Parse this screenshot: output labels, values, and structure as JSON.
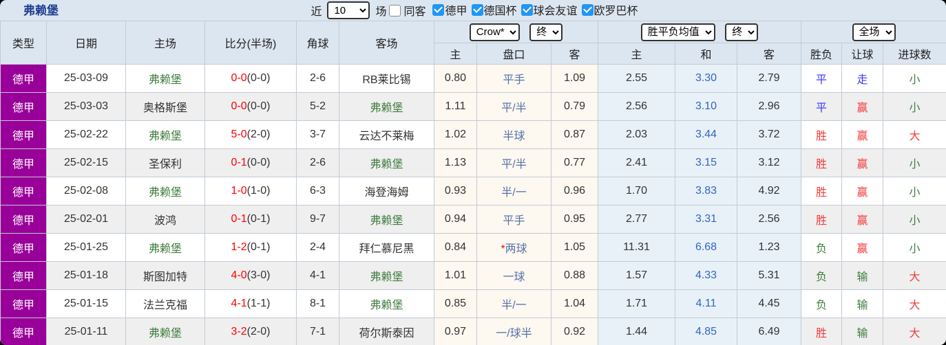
{
  "topbar": {
    "title": "弗赖堡",
    "near_label": "近",
    "games_select": "10",
    "games_label": "场",
    "same_away_label": "同客",
    "leagues": [
      {
        "label": "德甲",
        "checked": true
      },
      {
        "label": "德国杯",
        "checked": true
      },
      {
        "label": "球会友谊",
        "checked": true
      },
      {
        "label": "欧罗巴杯",
        "checked": true
      }
    ]
  },
  "header": {
    "static_cols": [
      "类型",
      "日期",
      "主场",
      "比分(半场)",
      "角球",
      "客场"
    ],
    "odds_group": {
      "bookmaker_select": "Crow*",
      "time_select": "终",
      "sub": [
        "主",
        "盘口",
        "客"
      ]
    },
    "avg_group": {
      "type_select": "胜平负均值",
      "time_select": "终",
      "sub": [
        "主",
        "和",
        "客"
      ]
    },
    "scope_group": {
      "scope_select": "全场",
      "sub": [
        "胜负",
        "让球",
        "进球数"
      ]
    }
  },
  "colors": {
    "league_badge": "#990099",
    "checkbox_accent": "#2196f3",
    "score_red": "#ff0000",
    "result_red": "#f43b3b",
    "result_blue": "#3b3bff",
    "result_green": "#3f7d3f",
    "draw_odds_blue": "#3465c0",
    "panel_bg": "#dce6f1"
  },
  "rows": [
    {
      "type": "德甲",
      "date": "25-03-09",
      "home": "弗赖堡",
      "home_color": "green",
      "score_ft": "0-0",
      "score_ht": "(0-0)",
      "corner": "2-6",
      "away": "RB莱比锡",
      "away_color": "dark",
      "odds_home": "0.80",
      "handicap": "平手",
      "handicap_star": false,
      "odds_away": "1.09",
      "avg_home": "2.55",
      "avg_draw": "3.30",
      "avg_away": "2.79",
      "result": "平",
      "result_color": "blue",
      "let_result": "走",
      "let_result_color": "blue",
      "goals": "小",
      "goals_color": "green"
    },
    {
      "type": "德甲",
      "date": "25-03-03",
      "home": "奥格斯堡",
      "home_color": "dark",
      "score_ft": "0-0",
      "score_ht": "(0-0)",
      "corner": "5-2",
      "away": "弗赖堡",
      "away_color": "green",
      "odds_home": "1.11",
      "handicap": "平/半",
      "handicap_star": false,
      "odds_away": "0.79",
      "avg_home": "2.56",
      "avg_draw": "3.10",
      "avg_away": "2.96",
      "result": "平",
      "result_color": "blue",
      "let_result": "赢",
      "let_result_color": "red",
      "goals": "小",
      "goals_color": "green"
    },
    {
      "type": "德甲",
      "date": "25-02-22",
      "home": "弗赖堡",
      "home_color": "green",
      "score_ft": "5-0",
      "score_ht": "(2-0)",
      "corner": "3-7",
      "away": "云达不莱梅",
      "away_color": "dark",
      "odds_home": "1.02",
      "handicap": "半球",
      "handicap_star": false,
      "odds_away": "0.87",
      "avg_home": "2.03",
      "avg_draw": "3.44",
      "avg_away": "3.72",
      "result": "胜",
      "result_color": "red",
      "let_result": "赢",
      "let_result_color": "red",
      "goals": "大",
      "goals_color": "red"
    },
    {
      "type": "德甲",
      "date": "25-02-15",
      "home": "圣保利",
      "home_color": "dark",
      "score_ft": "0-1",
      "score_ht": "(0-0)",
      "corner": "2-6",
      "away": "弗赖堡",
      "away_color": "green",
      "odds_home": "1.13",
      "handicap": "平/半",
      "handicap_star": false,
      "odds_away": "0.77",
      "avg_home": "2.41",
      "avg_draw": "3.15",
      "avg_away": "3.12",
      "result": "胜",
      "result_color": "red",
      "let_result": "赢",
      "let_result_color": "red",
      "goals": "小",
      "goals_color": "green"
    },
    {
      "type": "德甲",
      "date": "25-02-08",
      "home": "弗赖堡",
      "home_color": "green",
      "score_ft": "1-0",
      "score_ht": "(1-0)",
      "corner": "6-3",
      "away": "海登海姆",
      "away_color": "dark",
      "odds_home": "0.93",
      "handicap": "半/一",
      "handicap_star": false,
      "odds_away": "0.96",
      "avg_home": "1.70",
      "avg_draw": "3.83",
      "avg_away": "4.92",
      "result": "胜",
      "result_color": "red",
      "let_result": "赢",
      "let_result_color": "red",
      "goals": "小",
      "goals_color": "green"
    },
    {
      "type": "德甲",
      "date": "25-02-01",
      "home": "波鸿",
      "home_color": "dark",
      "score_ft": "0-1",
      "score_ht": "(0-1)",
      "corner": "9-7",
      "away": "弗赖堡",
      "away_color": "green",
      "odds_home": "0.94",
      "handicap": "平手",
      "handicap_star": false,
      "odds_away": "0.95",
      "avg_home": "2.77",
      "avg_draw": "3.31",
      "avg_away": "2.56",
      "result": "胜",
      "result_color": "red",
      "let_result": "赢",
      "let_result_color": "red",
      "goals": "小",
      "goals_color": "green"
    },
    {
      "type": "德甲",
      "date": "25-01-25",
      "home": "弗赖堡",
      "home_color": "green",
      "score_ft": "1-2",
      "score_ht": "(0-1)",
      "corner": "2-4",
      "away": "拜仁慕尼黑",
      "away_color": "dark",
      "odds_home": "0.84",
      "handicap": "两球",
      "handicap_star": true,
      "odds_away": "1.05",
      "avg_home": "11.31",
      "avg_draw": "6.68",
      "avg_away": "1.23",
      "result": "负",
      "result_color": "green",
      "let_result": "赢",
      "let_result_color": "red",
      "goals": "小",
      "goals_color": "green"
    },
    {
      "type": "德甲",
      "date": "25-01-18",
      "home": "斯图加特",
      "home_color": "dark",
      "score_ft": "4-0",
      "score_ht": "(3-0)",
      "corner": "4-1",
      "away": "弗赖堡",
      "away_color": "green",
      "odds_home": "1.01",
      "handicap": "一球",
      "handicap_star": false,
      "odds_away": "0.88",
      "avg_home": "1.57",
      "avg_draw": "4.33",
      "avg_away": "5.31",
      "result": "负",
      "result_color": "green",
      "let_result": "输",
      "let_result_color": "green",
      "goals": "大",
      "goals_color": "red"
    },
    {
      "type": "德甲",
      "date": "25-01-15",
      "home": "法兰克福",
      "home_color": "dark",
      "score_ft": "4-1",
      "score_ht": "(1-1)",
      "corner": "8-1",
      "away": "弗赖堡",
      "away_color": "green",
      "odds_home": "0.85",
      "handicap": "半/一",
      "handicap_star": false,
      "odds_away": "1.04",
      "avg_home": "1.71",
      "avg_draw": "4.11",
      "avg_away": "4.45",
      "result": "负",
      "result_color": "green",
      "let_result": "输",
      "let_result_color": "green",
      "goals": "大",
      "goals_color": "red"
    },
    {
      "type": "德甲",
      "date": "25-01-11",
      "home": "弗赖堡",
      "home_color": "green",
      "score_ft": "3-2",
      "score_ht": "(2-0)",
      "corner": "7-1",
      "away": "荷尔斯泰因",
      "away_color": "dark",
      "odds_home": "0.97",
      "handicap": "一/球半",
      "handicap_star": false,
      "odds_away": "0.92",
      "avg_home": "1.44",
      "avg_draw": "4.85",
      "avg_away": "6.49",
      "result": "胜",
      "result_color": "red",
      "let_result": "输",
      "let_result_color": "green",
      "goals": "大",
      "goals_color": "red"
    }
  ]
}
